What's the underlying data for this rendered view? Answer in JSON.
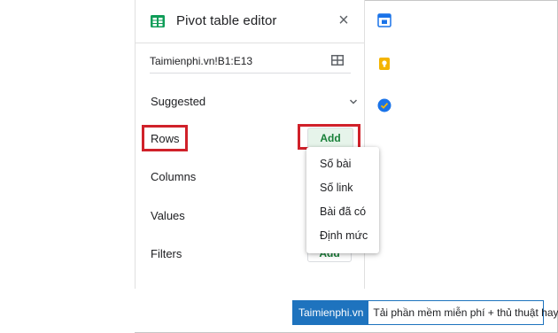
{
  "editor": {
    "title": "Pivot table editor",
    "close_symbol": "×",
    "range": "Taimienphi.vn!B1:E13"
  },
  "sections": {
    "suggested": "Suggested",
    "rows": "Rows",
    "columns": "Columns",
    "values": "Values",
    "filters": "Filters"
  },
  "buttons": {
    "add_rows": "Add",
    "add_filters": "Add"
  },
  "dropdown": {
    "items": [
      "Số bài",
      "Số link",
      "Bài đã có",
      "Định mức"
    ]
  },
  "watermark": {
    "logo": "Taimienphi.vn",
    "tagline": "Tải phần mềm miễn phí + thủ thuật hay"
  },
  "colors": {
    "sheets_green": "#0f9d58",
    "add_green": "#188038",
    "highlight_red": "#d0212a",
    "brand_blue": "#1e73be",
    "keep_yellow": "#f4b400",
    "tasks_blue": "#1a73e8"
  },
  "icons": {
    "sheets": "sheets-icon",
    "grid": "grid-select-icon",
    "chevron": "chevron-down-icon",
    "calendar": "calendar-icon",
    "keep": "keep-icon",
    "tasks": "tasks-icon"
  }
}
